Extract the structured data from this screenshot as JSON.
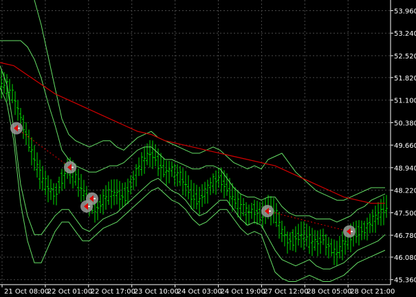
{
  "chart_data": {
    "type": "line",
    "title": "",
    "ylim": [
      45.2,
      54.3
    ],
    "grid": true,
    "colors": {
      "background": "#000000",
      "grid": "#4a4a4a",
      "axis": "#ffffff",
      "bars": "#00e000",
      "envelope": "#66e066",
      "moving_average": "#d40000",
      "signal_circle": "#9a9a9a",
      "signal_arrow": "#e00000"
    },
    "y_ticks": [
      "53.960",
      "53.240",
      "52.520",
      "51.820",
      "51.100",
      "50.380",
      "49.660",
      "48.940",
      "48.220",
      "47.500",
      "46.780",
      "46.080",
      "45.360"
    ],
    "y_tick_values": [
      53.96,
      53.24,
      52.52,
      51.82,
      51.1,
      50.38,
      49.66,
      48.94,
      48.22,
      47.5,
      46.78,
      46.08,
      45.36
    ],
    "x_ticks": [
      "21 Oct 08:00",
      "22 Oct 01:00",
      "22 Oct 17:00",
      "23 Oct 10:00",
      "24 Oct 03:00",
      "24 Oct 19:00",
      "27 Oct 12:00",
      "28 Oct 05:00",
      "28 Oct 21:00"
    ],
    "series": [
      {
        "type": "line",
        "x": [
          0,
          10,
          20,
          30,
          40,
          50,
          60,
          70,
          80,
          90,
          100,
          110,
          120,
          130,
          140,
          150,
          160,
          170,
          180,
          190,
          200,
          210,
          220,
          230,
          240,
          250,
          260,
          270,
          280,
          290,
          300,
          310,
          320,
          330,
          340,
          350,
          360,
          370,
          380,
          390,
          400,
          410,
          420,
          430,
          440,
          450,
          460,
          470,
          480,
          490,
          500,
          510,
          520,
          530,
          540,
          550,
          560
        ],
        "values": [
          51.6,
          51.5,
          51.2,
          50.6,
          49.9,
          49.2,
          48.6,
          48.3,
          48.1,
          48.6,
          48.9,
          48.6,
          48.2,
          47.8,
          47.6,
          47.9,
          48.1,
          48.1,
          48.0,
          48.4,
          48.9,
          49.2,
          49.4,
          49.1,
          48.8,
          48.9,
          48.7,
          48.4,
          48.0,
          47.9,
          48.2,
          48.5,
          48.6,
          48.3,
          47.9,
          47.7,
          47.5,
          47.6,
          47.4,
          47.6,
          47.5,
          46.9,
          46.6,
          46.7,
          46.8,
          46.6,
          46.5,
          46.7,
          46.4,
          46.2,
          46.5,
          46.7,
          46.9,
          47.0,
          47.2,
          47.4,
          47.6
        ]
      },
      {
        "type": "line",
        "x": [
          0,
          20,
          40,
          60,
          80,
          100,
          120,
          140,
          160,
          180,
          200,
          220,
          240,
          260,
          280,
          300,
          320,
          340,
          360,
          380,
          400,
          420,
          440,
          460,
          480,
          500,
          520,
          540,
          560
        ],
        "values": [
          52.3,
          52.2,
          51.9,
          51.6,
          51.3,
          51.1,
          50.9,
          50.7,
          50.5,
          50.3,
          50.1,
          50.0,
          49.8,
          49.7,
          49.6,
          49.5,
          49.4,
          49.3,
          49.2,
          49.1,
          49.0,
          48.8,
          48.6,
          48.4,
          48.2,
          48.0,
          47.9,
          47.8,
          47.8
        ]
      },
      {
        "type": "line",
        "x": [
          0,
          10,
          20,
          30,
          40,
          50,
          60,
          70,
          80,
          90,
          100,
          110,
          120,
          130,
          140,
          150,
          160,
          170,
          180,
          190,
          200,
          210,
          220,
          230,
          240,
          250,
          260,
          270,
          280,
          290,
          300,
          310,
          320,
          330,
          340,
          350,
          360,
          370,
          380,
          390,
          400,
          410,
          420,
          430,
          440,
          450,
          460,
          470,
          480,
          490,
          500,
          510,
          520,
          530,
          540,
          550,
          560
        ],
        "values": [
          54.5,
          54.5,
          54.5,
          54.5,
          54.5,
          54.3,
          53.5,
          52.5,
          51.5,
          50.5,
          50.0,
          49.8,
          49.7,
          49.6,
          49.7,
          49.8,
          49.8,
          49.6,
          49.5,
          49.7,
          49.9,
          50.0,
          50.1,
          49.9,
          49.8,
          49.7,
          49.6,
          49.5,
          49.4,
          49.4,
          49.5,
          49.6,
          49.5,
          49.3,
          49.1,
          49.0,
          48.9,
          49.0,
          48.9,
          49.2,
          49.3,
          49.4,
          49.1,
          48.8,
          48.6,
          48.4,
          48.2,
          48.1,
          48.0,
          47.9,
          47.9,
          48.0,
          48.1,
          48.2,
          48.3,
          48.3,
          48.3
        ]
      },
      {
        "type": "line",
        "x": [
          0,
          10,
          20,
          30,
          40,
          50,
          60,
          70,
          80,
          90,
          100,
          110,
          120,
          130,
          140,
          150,
          160,
          170,
          180,
          190,
          200,
          210,
          220,
          230,
          240,
          250,
          260,
          270,
          280,
          290,
          300,
          310,
          320,
          330,
          340,
          350,
          360,
          370,
          380,
          390,
          400,
          410,
          420,
          430,
          440,
          450,
          460,
          470,
          480,
          490,
          500,
          510,
          520,
          530,
          540,
          550,
          560
        ],
        "values": [
          53.0,
          53.0,
          53.0,
          53.0,
          52.8,
          52.4,
          51.8,
          51.0,
          50.3,
          49.5,
          49.2,
          49.0,
          48.9,
          48.8,
          48.8,
          48.9,
          49.0,
          49.0,
          49.1,
          49.3,
          49.5,
          49.6,
          49.6,
          49.4,
          49.2,
          49.2,
          49.1,
          49.0,
          48.9,
          48.9,
          49.0,
          49.0,
          48.9,
          48.6,
          48.3,
          48.1,
          48.0,
          48.0,
          47.9,
          48.0,
          48.0,
          47.7,
          47.5,
          47.4,
          47.4,
          47.4,
          47.3,
          47.3,
          47.3,
          47.2,
          47.3,
          47.4,
          47.6,
          47.7,
          47.9,
          48.0,
          48.1
        ]
      },
      {
        "type": "line",
        "x": [
          0,
          10,
          20,
          30,
          40,
          50,
          60,
          70,
          80,
          90,
          100,
          110,
          120,
          130,
          140,
          150,
          160,
          170,
          180,
          190,
          200,
          210,
          220,
          230,
          240,
          250,
          260,
          270,
          280,
          290,
          300,
          310,
          320,
          330,
          340,
          350,
          360,
          370,
          380,
          390,
          400,
          410,
          420,
          430,
          440,
          450,
          460,
          470,
          480,
          490,
          500,
          510,
          520,
          530,
          540,
          550,
          560
        ],
        "values": [
          52.2,
          51.6,
          50.2,
          48.4,
          47.4,
          46.8,
          46.8,
          47.1,
          47.4,
          47.6,
          47.6,
          47.3,
          47.0,
          46.9,
          47.1,
          47.3,
          47.4,
          47.5,
          47.7,
          47.9,
          48.1,
          48.3,
          48.5,
          48.6,
          48.4,
          48.2,
          48.1,
          47.9,
          47.6,
          47.4,
          47.5,
          47.7,
          47.9,
          47.9,
          47.6,
          47.3,
          47.1,
          47.2,
          47.1,
          46.7,
          46.3,
          46.0,
          45.9,
          45.8,
          45.9,
          46.0,
          45.8,
          45.7,
          45.7,
          45.8,
          45.9,
          46.1,
          46.3,
          46.4,
          46.5,
          46.6,
          46.8
        ]
      },
      {
        "type": "line",
        "x": [
          0,
          10,
          20,
          30,
          40,
          50,
          60,
          70,
          80,
          90,
          100,
          110,
          120,
          130,
          140,
          150,
          160,
          170,
          180,
          190,
          200,
          210,
          220,
          230,
          240,
          250,
          260,
          270,
          280,
          290,
          300,
          310,
          320,
          330,
          340,
          350,
          360,
          370,
          380,
          390,
          400,
          410,
          420,
          430,
          440,
          450,
          460,
          470,
          480,
          490,
          500,
          510,
          520,
          530,
          540,
          550,
          560
        ],
        "values": [
          51.5,
          51.0,
          49.8,
          47.8,
          46.6,
          45.9,
          45.9,
          46.4,
          46.9,
          47.2,
          47.2,
          46.9,
          46.6,
          46.6,
          46.8,
          47.0,
          47.1,
          47.2,
          47.4,
          47.6,
          47.8,
          48.0,
          48.2,
          48.3,
          48.1,
          47.9,
          47.8,
          47.6,
          47.3,
          47.1,
          47.2,
          47.4,
          47.6,
          47.6,
          47.3,
          47.0,
          46.8,
          46.9,
          46.8,
          46.2,
          45.6,
          45.4,
          45.3,
          45.3,
          45.4,
          45.5,
          45.4,
          45.3,
          45.3,
          45.4,
          45.5,
          45.7,
          45.9,
          46.0,
          46.1,
          46.2,
          46.3
        ]
      }
    ],
    "signals": [
      {
        "x": 24,
        "y": 50.2
      },
      {
        "x": 102,
        "y": 48.95
      },
      {
        "x": 126,
        "y": 47.7
      },
      {
        "x": 134,
        "y": 47.95
      },
      {
        "x": 389,
        "y": 47.55
      },
      {
        "x": 508,
        "y": 46.9
      }
    ]
  }
}
